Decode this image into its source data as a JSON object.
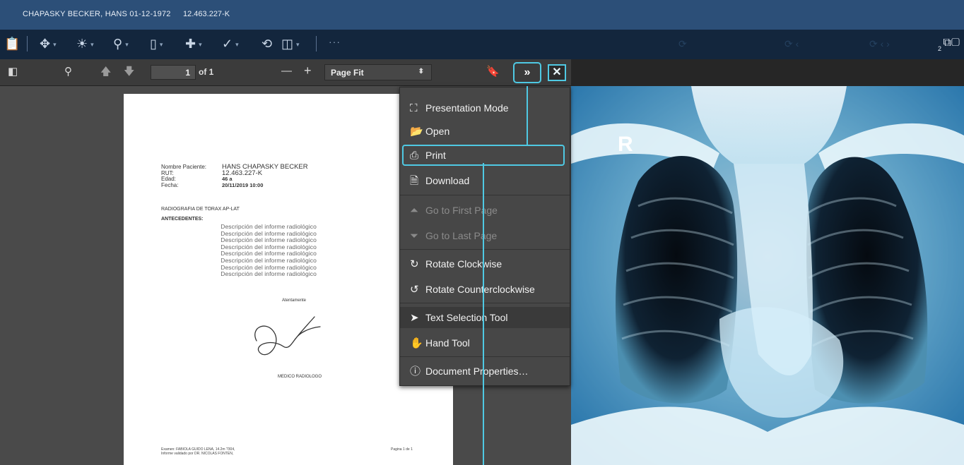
{
  "patient": {
    "header_name": "CHAPASKY BECKER, HANS  01-12-1972",
    "header_rut": "12.463.227-K"
  },
  "viewer_toolbar": {
    "tools": [
      {
        "name": "clipboard-icon",
        "glyph": "📋"
      },
      {
        "name": "pan-icon",
        "glyph": "✥"
      },
      {
        "name": "window-level-icon",
        "glyph": "☀"
      },
      {
        "name": "zoom-icon",
        "glyph": "⚲"
      },
      {
        "name": "measure-icon",
        "glyph": "▯"
      },
      {
        "name": "annotation-icon",
        "glyph": "✚"
      },
      {
        "name": "check-icon",
        "glyph": "✓"
      },
      {
        "name": "reset-icon",
        "glyph": "⟲"
      },
      {
        "name": "cube-icon",
        "glyph": "◫"
      }
    ],
    "more_label": "···",
    "layout_count": "2"
  },
  "pdf_toolbar": {
    "page_number": "1",
    "page_count": "of 1",
    "zoom_minus": "—",
    "zoom_plus": "+",
    "zoom_value": "Page Fit",
    "tools_button": "»",
    "close_button": "✕"
  },
  "document": {
    "fields": [
      {
        "label": "Nombre Paciente:",
        "value": "HANS CHAPASKY BECKER"
      },
      {
        "label": "RUT:",
        "value": "12.463.227-K"
      },
      {
        "label": "Edad:",
        "value": "46 a"
      },
      {
        "label": "Fecha:",
        "value": "20/11/2019 10:00"
      }
    ],
    "study": "RADIOGRAFIA DE TORAX AP-LAT",
    "antecedentes": "ANTECEDENTES:",
    "descriptions": [
      "Descripción del informe radiológico",
      "Descripción del informe radiológico",
      "Descripción del informe radiológico",
      "Descripción del informe radiológico",
      "Descripción del informe radiológico",
      "Descripción del informe radiológico",
      "Descripción del informe radiológico",
      "Descripción del informe radiológico"
    ],
    "closing": "Atentamente",
    "signer": "MEDICO RADIOLOGO",
    "footer_line1": "Examen: FABIOLA GUIDO LENA, 14.2m ?304,",
    "footer_line2": "Informe validado por DR. NICOLAS FONTEN,",
    "page_label": "Pagina 1 de 1"
  },
  "tools_menu": {
    "items": [
      {
        "label": "Presentation Mode",
        "icon": "fullscreen-icon",
        "glyph": "⛶",
        "enabled": true
      },
      {
        "label": "Open",
        "icon": "open-file-icon",
        "glyph": "📂",
        "enabled": true
      },
      {
        "label": "Print",
        "icon": "print-icon",
        "glyph": "⎙",
        "enabled": true,
        "highlighted": true
      },
      {
        "label": "Download",
        "icon": "download-icon",
        "glyph": "🗎",
        "enabled": true
      },
      {
        "label": "Go to First Page",
        "icon": "first-page-icon",
        "glyph": "⏶",
        "enabled": false
      },
      {
        "label": "Go to Last Page",
        "icon": "last-page-icon",
        "glyph": "⏷",
        "enabled": false
      },
      {
        "label": "Rotate Clockwise",
        "icon": "rotate-cw-icon",
        "glyph": "↻",
        "enabled": true
      },
      {
        "label": "Rotate Counterclockwise",
        "icon": "rotate-ccw-icon",
        "glyph": "↺",
        "enabled": true
      },
      {
        "label": "Text Selection Tool",
        "icon": "cursor-icon",
        "glyph": "➤",
        "enabled": true,
        "selected": true
      },
      {
        "label": "Hand Tool",
        "icon": "hand-icon",
        "glyph": "✋",
        "enabled": true
      },
      {
        "label": "Document Properties…",
        "icon": "info-icon",
        "glyph": "ⓘ",
        "enabled": true
      }
    ]
  },
  "xray": {
    "marker": "R"
  },
  "colors": {
    "header": "#2c4f78",
    "toolbar": "#13263d",
    "accent": "#4fc9e3"
  }
}
